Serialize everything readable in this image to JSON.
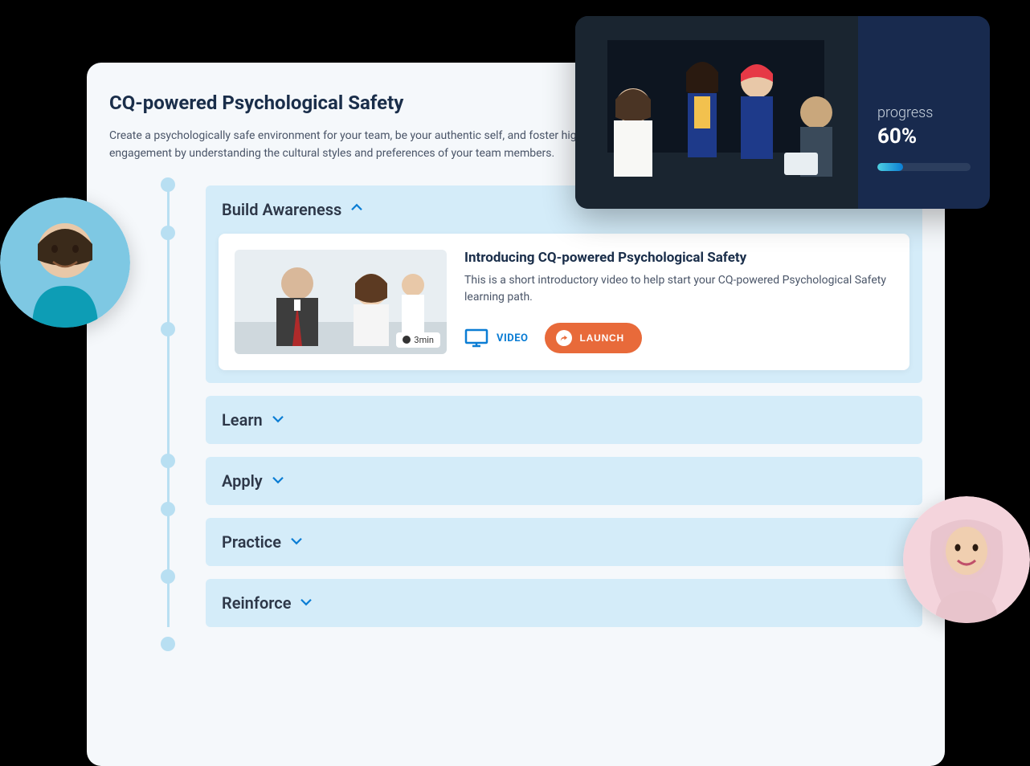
{
  "header": {
    "title": "CQ-powered Psychological Safety",
    "description": "Create a psychologically safe environment for your team, be your authentic self, and foster high engagement by understanding the cultural styles and preferences of your team members."
  },
  "hero": {
    "progress_label": "progress",
    "progress_value": "60%",
    "progress_percent": 60
  },
  "sections": [
    {
      "title": "Build Awareness",
      "expanded": true,
      "lesson": {
        "title": "Introducing CQ-powered Psychological Safety",
        "description": "This is a short introductory video to help start your CQ-powered Psychological Safety learning path.",
        "duration": "3min",
        "type_label": "VIDEO",
        "launch_label": "LAUNCH"
      }
    },
    {
      "title": "Learn",
      "expanded": false
    },
    {
      "title": "Apply",
      "expanded": false
    },
    {
      "title": "Practice",
      "expanded": false
    },
    {
      "title": "Reinforce",
      "expanded": false
    }
  ]
}
